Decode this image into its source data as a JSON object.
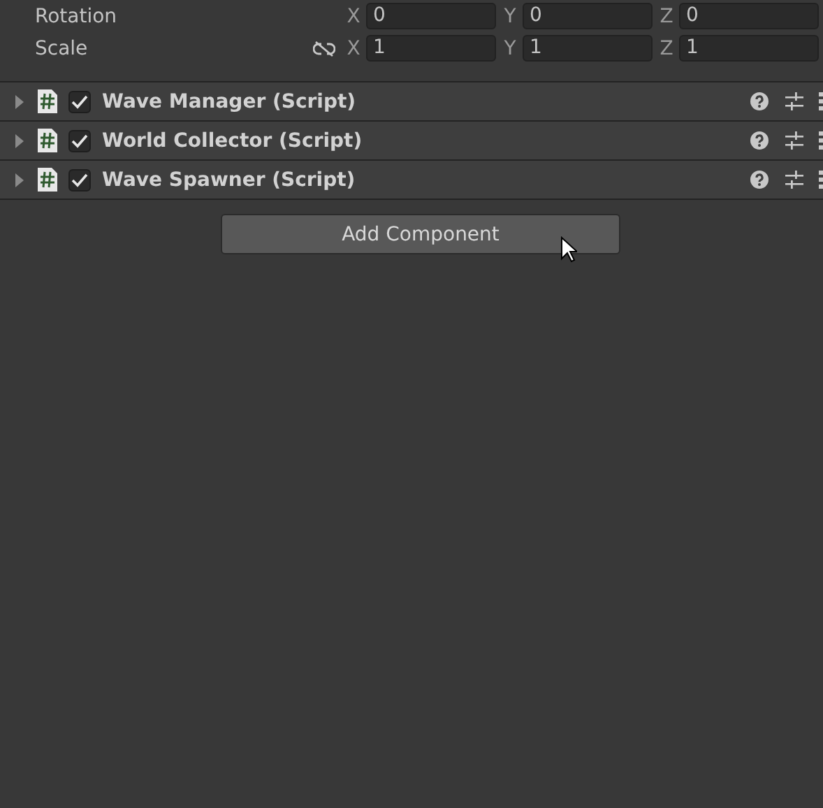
{
  "transform": [
    {
      "kind": "vector",
      "label": "Rotation",
      "fields": [
        {
          "axis": "X",
          "value": "0"
        },
        {
          "axis": "Y",
          "value": "0"
        },
        {
          "axis": "Z",
          "value": "0"
        }
      ]
    },
    {
      "kind": "scale",
      "label": "Scale",
      "linked": false,
      "fields": [
        {
          "axis": "X",
          "value": "1"
        },
        {
          "axis": "Y",
          "value": "1"
        },
        {
          "axis": "Z",
          "value": "1"
        }
      ]
    }
  ],
  "components": [
    {
      "title": "Wave Manager (Script)",
      "expanded": false,
      "enabled": true
    },
    {
      "title": "World Collector (Script)",
      "expanded": false,
      "enabled": true
    },
    {
      "title": "Wave Spawner (Script)",
      "expanded": false,
      "enabled": true
    }
  ],
  "add_button": "Add Component"
}
